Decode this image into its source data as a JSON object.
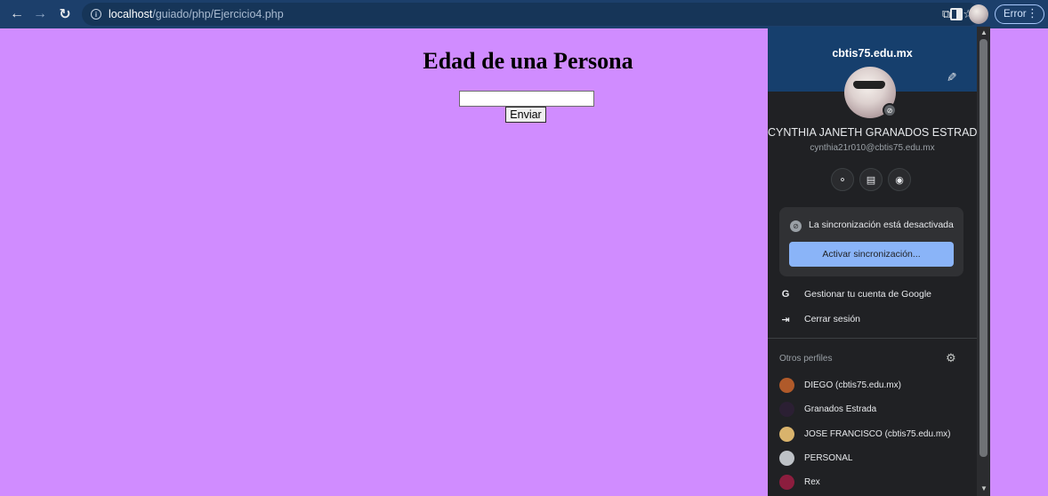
{
  "browser": {
    "url_host": "localhost",
    "url_path": "/guiado/php/Ejercicio4.php",
    "error_label": "Error",
    "icons": [
      "back-arrow-icon",
      "forward-arrow-icon",
      "reload-icon",
      "info-icon",
      "share-icon",
      "star-icon",
      "side-panel-icon",
      "profile-avatar",
      "kebab-menu-icon"
    ]
  },
  "page": {
    "title": "Edad de una Persona",
    "input_value": "",
    "submit_label": "Enviar",
    "background_color": "#d08cff"
  },
  "profile_panel": {
    "domain": "cbtis75.edu.mx",
    "name": "CYNTHIA JANETH GRANADOS ESTRADA",
    "email": "cynthia21r010@cbtis75.edu.mx",
    "sync_status": "La sincronización está desactivada",
    "sync_button": "Activar sincronización...",
    "manage_account": "Gestionar tu cuenta de Google",
    "sign_out": "Cerrar sesión",
    "other_profiles_title": "Otros perfiles",
    "other_profiles": [
      {
        "name": "DIEGO (cbtis75.edu.mx)",
        "color": "#b05a2a"
      },
      {
        "name": "Granados Estrada",
        "color": "#2b1f33"
      },
      {
        "name": "JOSE FRANCISCO (cbtis75.edu.mx)",
        "color": "#d9b36c"
      },
      {
        "name": "PERSONAL",
        "color": "#bdc1c6"
      },
      {
        "name": "Rex",
        "color": "#8c1d3e"
      }
    ],
    "accent_color": "#8ab4f8",
    "header_color": "#163f6d"
  }
}
